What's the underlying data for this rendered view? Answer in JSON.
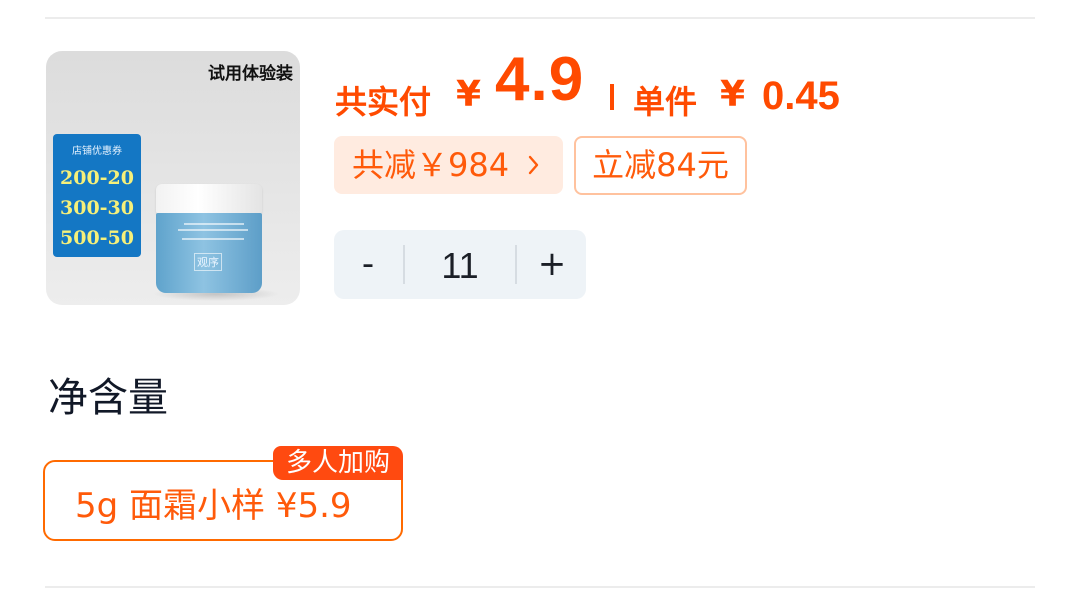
{
  "product": {
    "image_caption": "试用体验装",
    "coupon": {
      "title": "店铺优惠券",
      "lines": [
        "200-20",
        "300-30",
        "500-50"
      ]
    },
    "jar_brand": "观序"
  },
  "price": {
    "total_label": "共实付",
    "currency": "¥",
    "total_value": "4.9",
    "unit_label": "单件",
    "unit_value": "0.45",
    "accent_color": "#ff4a00"
  },
  "discount": {
    "total_saving": "共减￥984",
    "chevron_icon": "chevron-right-icon",
    "instant_tag": "立减84元"
  },
  "quantity": {
    "minus_label": "-",
    "value": "11",
    "plus_label": "+"
  },
  "spec_section": {
    "title": "净含量",
    "options": [
      {
        "label": "5g 面霜小样  ¥5.9",
        "badge": "多人加购",
        "selected": true
      }
    ]
  }
}
